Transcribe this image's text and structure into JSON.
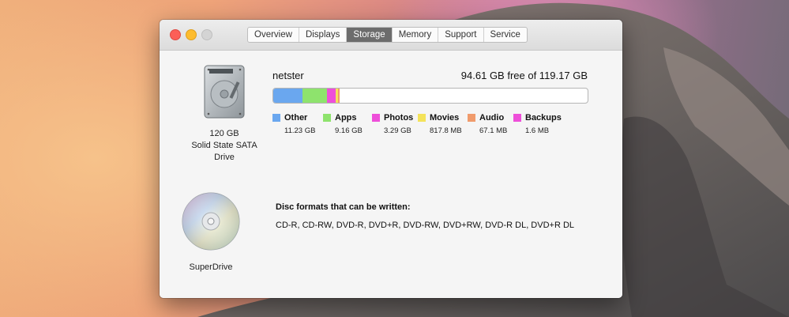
{
  "tabs": [
    {
      "label": "Overview"
    },
    {
      "label": "Displays"
    },
    {
      "label": "Storage"
    },
    {
      "label": "Memory"
    },
    {
      "label": "Support"
    },
    {
      "label": "Service"
    }
  ],
  "active_tab": "Storage",
  "storage": {
    "drive": {
      "capacity": "120 GB",
      "type_line1": "Solid State SATA",
      "type_line2": "Drive"
    },
    "volume_name": "netster",
    "free_summary": "94.61 GB free of 119.17 GB",
    "categories": [
      {
        "name": "Other",
        "size": "11.23 GB",
        "color": "#6aa7ef"
      },
      {
        "name": "Apps",
        "size": "9.16 GB",
        "color": "#8ee36d"
      },
      {
        "name": "Photos",
        "size": "3.29 GB",
        "color": "#ee4fd9"
      },
      {
        "name": "Movies",
        "size": "817.8 MB",
        "color": "#f4e35a"
      },
      {
        "name": "Audio",
        "size": "67.1 MB",
        "color": "#f09b6c"
      },
      {
        "name": "Backups",
        "size": "1.6 MB",
        "color": "#ee4fd9"
      }
    ]
  },
  "superdrive": {
    "label": "SuperDrive",
    "formats_title": "Disc formats that can be written:",
    "formats": "CD-R, CD-RW, DVD-R, DVD+R, DVD-RW, DVD+RW, DVD-R DL, DVD+R DL"
  }
}
